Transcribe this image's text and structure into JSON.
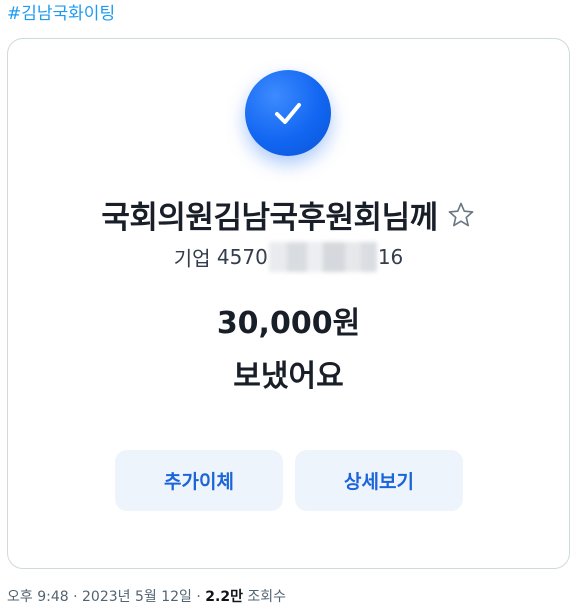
{
  "hashtag": "#김남국화이팅",
  "card": {
    "recipient": "국회의원김남국후원회님께",
    "account_bank": "기업",
    "account_prefix": "4570",
    "account_suffix": "16",
    "amount": "30,000원",
    "status": "보냈어요",
    "buttons": {
      "add_transfer": "추가이체",
      "details": "상세보기"
    },
    "icons": {
      "badge": "check-icon",
      "favorite": "star-outline-icon"
    },
    "colors": {
      "accent": "#1266f1",
      "button_text": "#1b64da",
      "button_bg": "#eef4fb"
    }
  },
  "meta": {
    "time": "오후 9:48",
    "separator": " · ",
    "date": "2023년 5월 12일",
    "views_count": "2.2만",
    "views_label": " 조회수"
  }
}
